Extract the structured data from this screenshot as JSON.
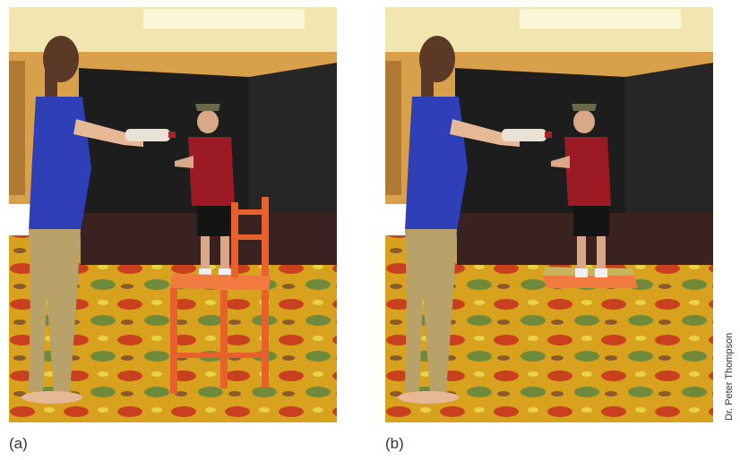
{
  "figure": {
    "panel_a_label": "(a)",
    "panel_b_label": "(b)",
    "credit": "Dr. Peter Thompson"
  },
  "colors": {
    "ceiling": "#f2e6b0",
    "wall": "#d8a04a",
    "partition": "#1d1d1d",
    "curtain": "#3a2220",
    "carpet_base": "#d9a21e",
    "carpet_red": "#c8401e",
    "carpet_green": "#6f8a3a",
    "woman_top": "#2f3fb8",
    "woman_pants": "#b8a26a",
    "man_shirt": "#9c1a24",
    "chair": "#e8602c"
  }
}
